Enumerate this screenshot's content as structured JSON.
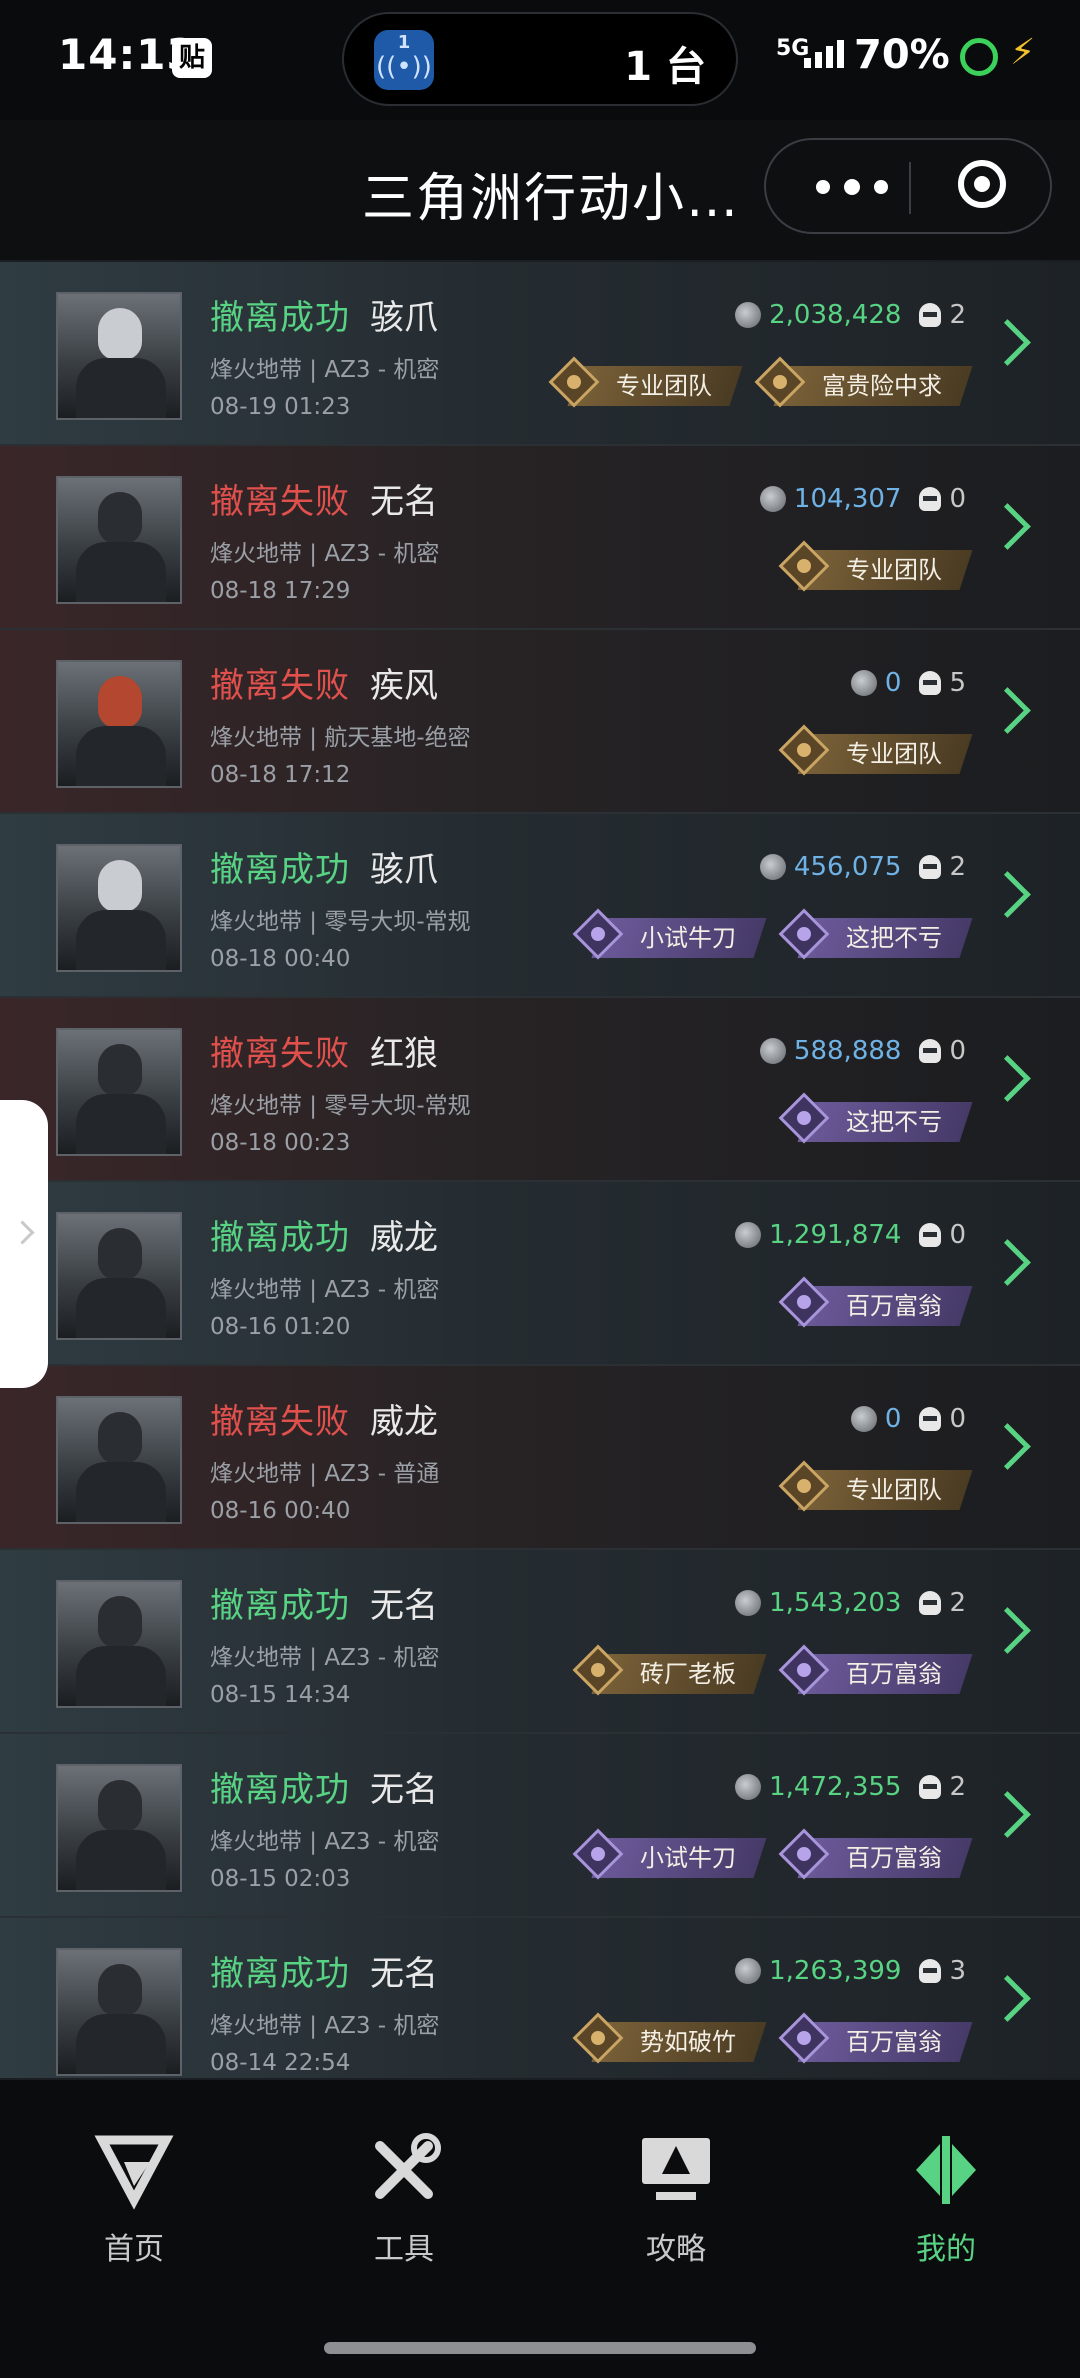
{
  "status_bar": {
    "time": "14:13",
    "note_icon": "贴",
    "island_icon_num": "1",
    "island_count": "1 台",
    "network": "5G",
    "battery": "70%"
  },
  "header": {
    "title": "三角洲行动小…",
    "more_icon": "more-dots-icon",
    "target_icon": "target-icon"
  },
  "records": [
    {
      "status": "撤离成功",
      "result": "success",
      "operator": "骇爪",
      "map": "烽火地带 | AZ3 - 机密",
      "time": "08-19 01:23",
      "value": "2,038,428",
      "value_color": "green",
      "kills": "2",
      "avatar": "silver",
      "badges": [
        {
          "label": "专业团队",
          "style": "gold"
        },
        {
          "label": "富贵险中求",
          "style": "gold"
        }
      ]
    },
    {
      "status": "撤离失败",
      "result": "fail",
      "operator": "无名",
      "map": "烽火地带 | AZ3 - 机密",
      "time": "08-18 17:29",
      "value": "104,307",
      "value_color": "blue",
      "kills": "0",
      "avatar": "dark",
      "badges": [
        {
          "label": "专业团队",
          "style": "gold"
        }
      ]
    },
    {
      "status": "撤离失败",
      "result": "fail",
      "operator": "疾风",
      "map": "烽火地带 | 航天基地-绝密",
      "time": "08-18 17:12",
      "value": "0",
      "value_color": "blue",
      "kills": "5",
      "avatar": "red",
      "badges": [
        {
          "label": "专业团队",
          "style": "gold"
        }
      ]
    },
    {
      "status": "撤离成功",
      "result": "success",
      "operator": "骇爪",
      "map": "烽火地带 | 零号大坝-常规",
      "time": "08-18 00:40",
      "value": "456,075",
      "value_color": "blue",
      "kills": "2",
      "avatar": "silver",
      "badges": [
        {
          "label": "小试牛刀",
          "style": "purple"
        },
        {
          "label": "这把不亏",
          "style": "purple"
        }
      ]
    },
    {
      "status": "撤离失败",
      "result": "fail",
      "operator": "红狼",
      "map": "烽火地带 | 零号大坝-常规",
      "time": "08-18 00:23",
      "value": "588,888",
      "value_color": "blue",
      "kills": "0",
      "avatar": "dark",
      "badges": [
        {
          "label": "这把不亏",
          "style": "purple"
        }
      ]
    },
    {
      "status": "撤离成功",
      "result": "success",
      "operator": "威龙",
      "map": "烽火地带 | AZ3 - 机密",
      "time": "08-16 01:20",
      "value": "1,291,874",
      "value_color": "green",
      "kills": "0",
      "avatar": "dark",
      "badges": [
        {
          "label": "百万富翁",
          "style": "purple"
        }
      ]
    },
    {
      "status": "撤离失败",
      "result": "fail",
      "operator": "威龙",
      "map": "烽火地带 | AZ3 - 普通",
      "time": "08-16 00:40",
      "value": "0",
      "value_color": "blue",
      "kills": "0",
      "avatar": "dark",
      "badges": [
        {
          "label": "专业团队",
          "style": "gold"
        }
      ]
    },
    {
      "status": "撤离成功",
      "result": "success",
      "operator": "无名",
      "map": "烽火地带 | AZ3 - 机密",
      "time": "08-15 14:34",
      "value": "1,543,203",
      "value_color": "green",
      "kills": "2",
      "avatar": "dark",
      "badges": [
        {
          "label": "砖厂老板",
          "style": "gold"
        },
        {
          "label": "百万富翁",
          "style": "purple"
        }
      ]
    },
    {
      "status": "撤离成功",
      "result": "success",
      "operator": "无名",
      "map": "烽火地带 | AZ3 - 机密",
      "time": "08-15 02:03",
      "value": "1,472,355",
      "value_color": "green",
      "kills": "2",
      "avatar": "dark",
      "badges": [
        {
          "label": "小试牛刀",
          "style": "purple"
        },
        {
          "label": "百万富翁",
          "style": "purple"
        }
      ]
    },
    {
      "status": "撤离成功",
      "result": "success",
      "operator": "无名",
      "map": "烽火地带 | AZ3 - 机密",
      "time": "08-14 22:54",
      "value": "1,263,399",
      "value_color": "green",
      "kills": "3",
      "avatar": "dark",
      "badges": [
        {
          "label": "势如破竹",
          "style": "gold"
        },
        {
          "label": "百万富翁",
          "style": "purple"
        }
      ]
    }
  ],
  "nav": [
    {
      "label": "首页",
      "icon": "home-logo-icon",
      "active": false
    },
    {
      "label": "工具",
      "icon": "tools-icon",
      "active": false
    },
    {
      "label": "攻略",
      "icon": "guide-monitor-icon",
      "active": false
    },
    {
      "label": "我的",
      "icon": "profile-logo-icon",
      "active": true
    }
  ],
  "colors": {
    "success": "#58d384",
    "fail": "#e0504d",
    "value_blue": "#6fb3e6",
    "active_nav": "#58d384"
  }
}
